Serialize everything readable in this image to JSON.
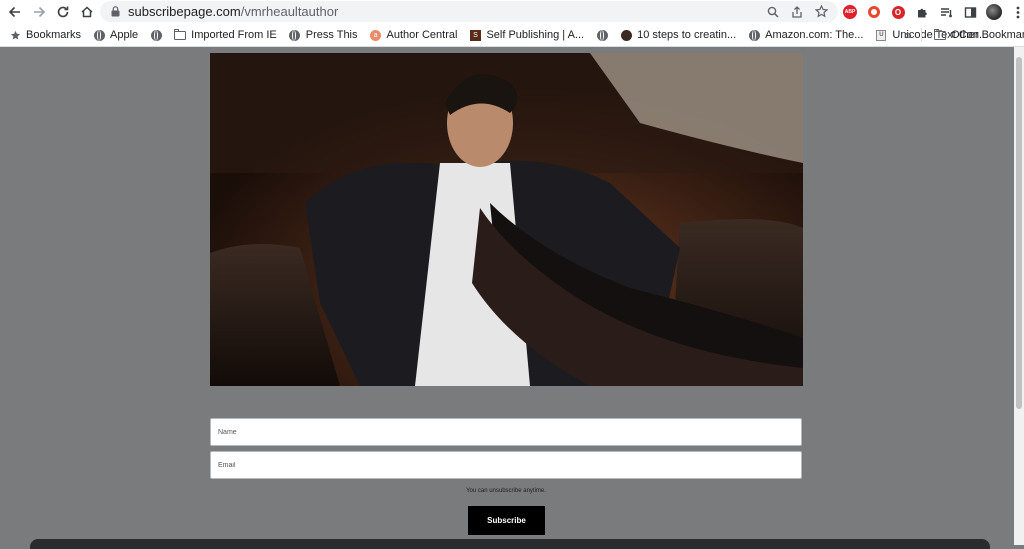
{
  "browser": {
    "url_domain": "subscribepage.com",
    "url_path": "/vmrheaultauthor",
    "extensions": {
      "abp_label": "ABP",
      "red_label": "O"
    },
    "bookmarks": [
      {
        "label": "Bookmarks",
        "icon": "star-icon"
      },
      {
        "label": "Apple",
        "icon": "globe-icon"
      },
      {
        "label": "",
        "icon": "globe-icon"
      },
      {
        "label": "Imported From IE",
        "icon": "folder-icon"
      },
      {
        "label": "Press This",
        "icon": "globe-icon"
      },
      {
        "label": "Author Central",
        "icon": "author-central-icon"
      },
      {
        "label": "Self Publishing | A...",
        "icon": "self-publishing-icon"
      },
      {
        "label": "",
        "icon": "globe-icon"
      },
      {
        "label": "10 steps to creatin...",
        "icon": "face-icon"
      },
      {
        "label": "Amazon.com: The...",
        "icon": "globe-icon"
      },
      {
        "label": "Unicode Text Con...",
        "icon": "unicode-icon"
      }
    ],
    "bookmarks_more": "»",
    "other_bookmarks": "Other Bookmarks"
  },
  "form": {
    "name_placeholder": "Name",
    "email_placeholder": "Email",
    "note": "You can unsubscribe anytime.",
    "subscribe_label": "Subscribe"
  }
}
